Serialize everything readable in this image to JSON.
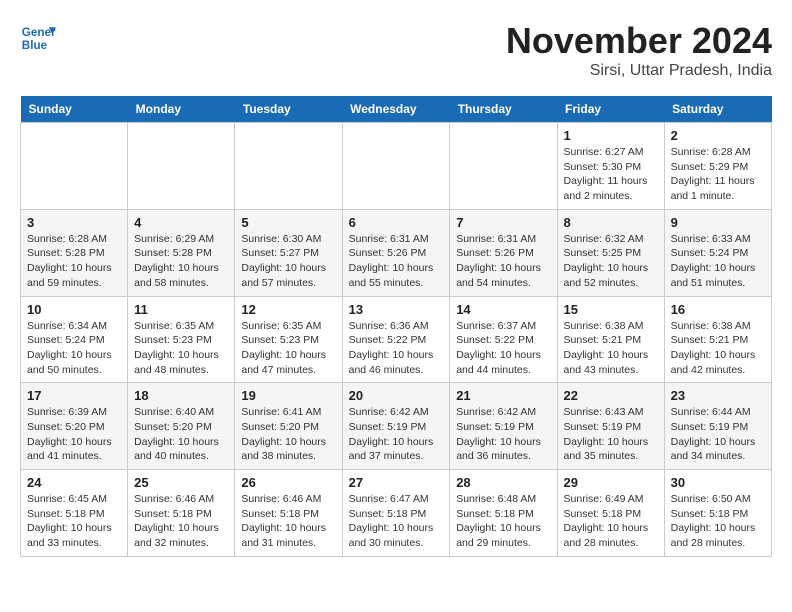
{
  "logo": {
    "line1": "General",
    "line2": "Blue"
  },
  "title": "November 2024",
  "subtitle": "Sirsi, Uttar Pradesh, India",
  "days_of_week": [
    "Sunday",
    "Monday",
    "Tuesday",
    "Wednesday",
    "Thursday",
    "Friday",
    "Saturday"
  ],
  "weeks": [
    [
      {
        "day": "",
        "info": ""
      },
      {
        "day": "",
        "info": ""
      },
      {
        "day": "",
        "info": ""
      },
      {
        "day": "",
        "info": ""
      },
      {
        "day": "",
        "info": ""
      },
      {
        "day": "1",
        "info": "Sunrise: 6:27 AM\nSunset: 5:30 PM\nDaylight: 11 hours and 2 minutes."
      },
      {
        "day": "2",
        "info": "Sunrise: 6:28 AM\nSunset: 5:29 PM\nDaylight: 11 hours and 1 minute."
      }
    ],
    [
      {
        "day": "3",
        "info": "Sunrise: 6:28 AM\nSunset: 5:28 PM\nDaylight: 10 hours and 59 minutes."
      },
      {
        "day": "4",
        "info": "Sunrise: 6:29 AM\nSunset: 5:28 PM\nDaylight: 10 hours and 58 minutes."
      },
      {
        "day": "5",
        "info": "Sunrise: 6:30 AM\nSunset: 5:27 PM\nDaylight: 10 hours and 57 minutes."
      },
      {
        "day": "6",
        "info": "Sunrise: 6:31 AM\nSunset: 5:26 PM\nDaylight: 10 hours and 55 minutes."
      },
      {
        "day": "7",
        "info": "Sunrise: 6:31 AM\nSunset: 5:26 PM\nDaylight: 10 hours and 54 minutes."
      },
      {
        "day": "8",
        "info": "Sunrise: 6:32 AM\nSunset: 5:25 PM\nDaylight: 10 hours and 52 minutes."
      },
      {
        "day": "9",
        "info": "Sunrise: 6:33 AM\nSunset: 5:24 PM\nDaylight: 10 hours and 51 minutes."
      }
    ],
    [
      {
        "day": "10",
        "info": "Sunrise: 6:34 AM\nSunset: 5:24 PM\nDaylight: 10 hours and 50 minutes."
      },
      {
        "day": "11",
        "info": "Sunrise: 6:35 AM\nSunset: 5:23 PM\nDaylight: 10 hours and 48 minutes."
      },
      {
        "day": "12",
        "info": "Sunrise: 6:35 AM\nSunset: 5:23 PM\nDaylight: 10 hours and 47 minutes."
      },
      {
        "day": "13",
        "info": "Sunrise: 6:36 AM\nSunset: 5:22 PM\nDaylight: 10 hours and 46 minutes."
      },
      {
        "day": "14",
        "info": "Sunrise: 6:37 AM\nSunset: 5:22 PM\nDaylight: 10 hours and 44 minutes."
      },
      {
        "day": "15",
        "info": "Sunrise: 6:38 AM\nSunset: 5:21 PM\nDaylight: 10 hours and 43 minutes."
      },
      {
        "day": "16",
        "info": "Sunrise: 6:38 AM\nSunset: 5:21 PM\nDaylight: 10 hours and 42 minutes."
      }
    ],
    [
      {
        "day": "17",
        "info": "Sunrise: 6:39 AM\nSunset: 5:20 PM\nDaylight: 10 hours and 41 minutes."
      },
      {
        "day": "18",
        "info": "Sunrise: 6:40 AM\nSunset: 5:20 PM\nDaylight: 10 hours and 40 minutes."
      },
      {
        "day": "19",
        "info": "Sunrise: 6:41 AM\nSunset: 5:20 PM\nDaylight: 10 hours and 38 minutes."
      },
      {
        "day": "20",
        "info": "Sunrise: 6:42 AM\nSunset: 5:19 PM\nDaylight: 10 hours and 37 minutes."
      },
      {
        "day": "21",
        "info": "Sunrise: 6:42 AM\nSunset: 5:19 PM\nDaylight: 10 hours and 36 minutes."
      },
      {
        "day": "22",
        "info": "Sunrise: 6:43 AM\nSunset: 5:19 PM\nDaylight: 10 hours and 35 minutes."
      },
      {
        "day": "23",
        "info": "Sunrise: 6:44 AM\nSunset: 5:19 PM\nDaylight: 10 hours and 34 minutes."
      }
    ],
    [
      {
        "day": "24",
        "info": "Sunrise: 6:45 AM\nSunset: 5:18 PM\nDaylight: 10 hours and 33 minutes."
      },
      {
        "day": "25",
        "info": "Sunrise: 6:46 AM\nSunset: 5:18 PM\nDaylight: 10 hours and 32 minutes."
      },
      {
        "day": "26",
        "info": "Sunrise: 6:46 AM\nSunset: 5:18 PM\nDaylight: 10 hours and 31 minutes."
      },
      {
        "day": "27",
        "info": "Sunrise: 6:47 AM\nSunset: 5:18 PM\nDaylight: 10 hours and 30 minutes."
      },
      {
        "day": "28",
        "info": "Sunrise: 6:48 AM\nSunset: 5:18 PM\nDaylight: 10 hours and 29 minutes."
      },
      {
        "day": "29",
        "info": "Sunrise: 6:49 AM\nSunset: 5:18 PM\nDaylight: 10 hours and 28 minutes."
      },
      {
        "day": "30",
        "info": "Sunrise: 6:50 AM\nSunset: 5:18 PM\nDaylight: 10 hours and 28 minutes."
      }
    ]
  ]
}
